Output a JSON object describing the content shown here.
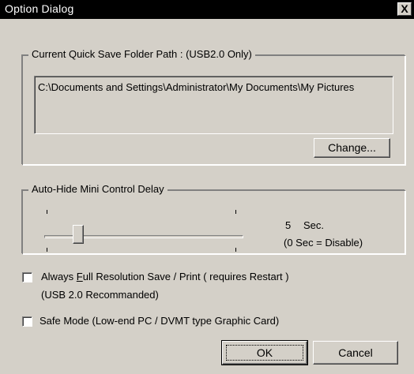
{
  "window": {
    "title": "Option Dialog",
    "close_glyph": "X"
  },
  "quick_save": {
    "group_label": "Current Quick Save Folder Path : (USB2.0 Only)",
    "path_value": "C:\\Documents and Settings\\Administrator\\My Documents\\My Pictures",
    "change_button": "Change..."
  },
  "auto_hide": {
    "group_label": "Auto-Hide Mini Control Delay",
    "slider_value_seconds": 5,
    "value_number": "5",
    "value_unit": "Sec.",
    "hint": "(0 Sec = Disable)"
  },
  "options": {
    "full_res": {
      "label_prefix": "Always ",
      "label_accel": "F",
      "label_rest": "ull Resolution Save / Print  ( requires Restart )",
      "sublabel": "(USB 2.0 Recommanded)",
      "checked": false
    },
    "safe_mode": {
      "label": "Safe Mode (Low-end PC / DVMT type Graphic Card)",
      "checked": false
    }
  },
  "buttons": {
    "ok": "OK",
    "cancel": "Cancel"
  }
}
